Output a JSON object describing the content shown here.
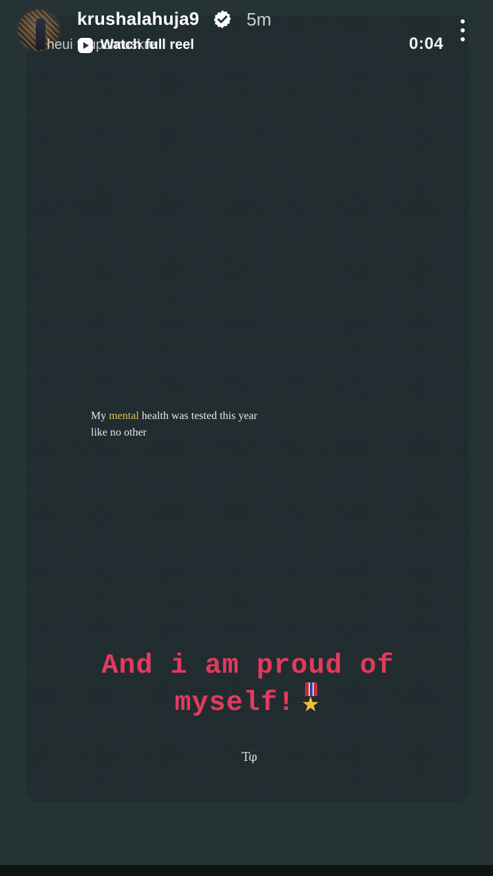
{
  "header": {
    "username": "krushalahuja9",
    "time_ago": "5m",
    "verified_icon": "verified-badge-icon",
    "more_icon": "more-vertical-icon",
    "avatar": "profile-avatar"
  },
  "reel_link": {
    "overlap_text": "heui toupchruskre",
    "icon": "reels-icon",
    "label": "Watch full reel"
  },
  "timer": "0:04",
  "caption": {
    "before": "My ",
    "highlight": "mental",
    "after": " health was tested this year like no other",
    "highlight_color": "#e0c45a"
  },
  "sticker": {
    "line1": "And i am proud of",
    "line2": "myself!",
    "emoji": "military-medal-icon",
    "color": "#e33a5e"
  },
  "watermark": "Tφ"
}
